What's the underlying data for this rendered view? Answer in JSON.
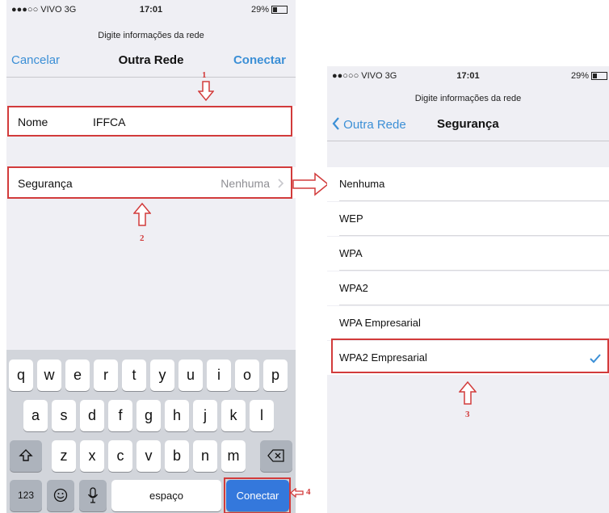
{
  "left": {
    "status": {
      "carrier": "●●●○○ VIVO  3G",
      "time": "17:01",
      "battery": "29%"
    },
    "subtitle": "Digite informações da rede",
    "nav": {
      "cancel": "Cancelar",
      "title": "Outra Rede",
      "connect": "Conectar"
    },
    "name_field": {
      "label": "Nome",
      "value": "IFFCA"
    },
    "security_row": {
      "label": "Segurança",
      "value": "Nenhuma",
      "chevron": "chevron-right-icon"
    },
    "annotations": {
      "one": "1",
      "two": "2",
      "four": "4"
    },
    "keyboard": {
      "row1": [
        "q",
        "w",
        "e",
        "r",
        "t",
        "y",
        "u",
        "i",
        "o",
        "p"
      ],
      "row2": [
        "a",
        "s",
        "d",
        "f",
        "g",
        "h",
        "j",
        "k",
        "l"
      ],
      "row3": [
        "z",
        "x",
        "c",
        "v",
        "b",
        "n",
        "m"
      ],
      "shift_icon": "shift-icon",
      "delete_icon": "backspace-icon",
      "numbers": "123",
      "emoji_icon": "emoji-icon",
      "mic_icon": "microphone-icon",
      "space": "espaço",
      "connect": "Conectar"
    }
  },
  "right": {
    "status": {
      "carrier": "●●○○○ VIVO  3G",
      "time": "17:01",
      "battery": "29%"
    },
    "subtitle": "Digite informações da rede",
    "nav": {
      "back": "Outra Rede",
      "title": "Segurança"
    },
    "options": [
      "Nenhuma",
      "WEP",
      "WPA",
      "WPA2",
      "WPA Empresarial",
      "WPA2 Empresarial"
    ],
    "selected_index": 5,
    "annotation": "3"
  },
  "colors": {
    "accent": "#3b8fd6",
    "annotation_red": "#d23b3b",
    "keyboard_blue": "#3478dc"
  }
}
